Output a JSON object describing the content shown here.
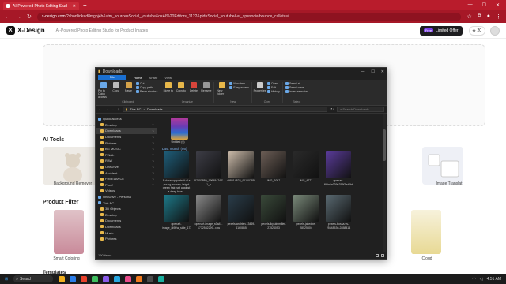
{
  "browser": {
    "tab_title": "AI-Powered Photo Editing Stud",
    "url_domain": "x-design.com",
    "url_rest": "/?shortlink=d8mgpj4h&utm_source=Social_youtube&c=AI%20Editors_1122&pid=Social_youtube&af_sp=socialbounce_callet=ui",
    "window_controls": [
      "—",
      "☐",
      "✕"
    ]
  },
  "site": {
    "logo_letter": "X",
    "logo_text": "X-Design",
    "tagline": "AI-Powered Photo Editing Studio for Product Images",
    "offer_badge": "Free",
    "offer_text": "Limited Offer",
    "credits": "20",
    "sections": {
      "ai_tools": "AI Tools",
      "product_filter": "Product Filter",
      "templates": "Templates"
    },
    "ai_tools": [
      {
        "label": "Background Remover"
      },
      {
        "label": "Image Translat"
      }
    ],
    "filters": [
      {
        "label": "Smart Coloring"
      },
      {
        "label": "Cloud"
      }
    ]
  },
  "explorer": {
    "title": "Downloads",
    "ribbon_tabs": [
      "File",
      "Home",
      "Share",
      "View"
    ],
    "ribbon": {
      "clipboard": {
        "label": "Clipboard",
        "pin": "Pin to Quick access",
        "copy": "Copy",
        "paste": "Paste",
        "cut": "Cut",
        "copy_path": "Copy path",
        "paste_shortcut": "Paste shortcut"
      },
      "organize": {
        "label": "Organize",
        "move_to": "Move to",
        "copy_to": "Copy to",
        "delete": "Delete",
        "rename": "Rename"
      },
      "new": {
        "label": "New",
        "new_folder": "New folder",
        "new_item": "New item",
        "easy_access": "Easy access"
      },
      "open": {
        "label": "Open",
        "properties": "Properties",
        "open": "Open",
        "edit": "Edit",
        "history": "History"
      },
      "select": {
        "label": "Select",
        "select_all": "Select all",
        "select_none": "Select none",
        "invert": "Invert selection"
      }
    },
    "breadcrumb": [
      "This PC",
      "Downloads"
    ],
    "search_placeholder": "Search Downloads",
    "nav": [
      {
        "label": "Quick access",
        "section": true
      },
      {
        "label": "Desktop",
        "pin": true
      },
      {
        "label": "Downloads",
        "pin": true,
        "selected": true
      },
      {
        "label": "Documents",
        "pin": true
      },
      {
        "label": "Pictures",
        "pin": true
      },
      {
        "label": "BG MUSIC",
        "pin": true
      },
      {
        "label": "FINAL",
        "pin": true
      },
      {
        "label": "RAW",
        "pin": true
      },
      {
        "label": "OneDrive",
        "pin": true
      },
      {
        "label": "Accident",
        "pin": true
      },
      {
        "label": "FREELANCE",
        "pin": true
      },
      {
        "label": "Proof",
        "pin": true
      },
      {
        "label": "Videos",
        "pin": false
      },
      {
        "label": "OneDrive - Personal",
        "section": true
      },
      {
        "label": "This PC",
        "section": true
      },
      {
        "label": "3D Objects",
        "pin": false
      },
      {
        "label": "Desktop",
        "pin": false
      },
      {
        "label": "Documents",
        "pin": false
      },
      {
        "label": "Downloads",
        "pin": false
      },
      {
        "label": "Music",
        "pin": false
      },
      {
        "label": "Pictures",
        "pin": false
      }
    ],
    "top_file": {
      "name": "Untitled (6)"
    },
    "group_label": "Last month (86)",
    "files_row1": [
      {
        "name": "A close-up portrait of a young woman, bright green hair, set against a deep blue...",
        "color": "#1e5e7a"
      },
      {
        "name": "87307889_1964847421560505_182140050...73848 1_n",
        "color": "#3d3d46"
      },
      {
        "name": "498514823_911602856875329_677419442...2566356_n",
        "color": "#c9b9a8"
      },
      {
        "name": "IMG_2087",
        "color": "#6b5d55"
      },
      {
        "name": "IMG_4777",
        "color": "#2a2a2a"
      },
      {
        "name": "openart-f99a5a039e259f2ed0bb6d7cc2e8e07_raw",
        "color": "#5a3b9a"
      }
    ],
    "files_row2": [
      {
        "name": "openart-image_8t9Ew_side_1732576...raw",
        "color": "#1d7a8a"
      },
      {
        "name": "openart-image_s0a4... 1732582299...raw",
        "color": "#8a8a8a"
      },
      {
        "name": "pexels-andrien...3469-4160865",
        "color": "#2a3d4a"
      },
      {
        "name": "pexels-lkyluksmiller-27524053",
        "color": "#3a4a3a"
      },
      {
        "name": "pexels-jakedpe-28525304",
        "color": "#7a8a7a"
      },
      {
        "name": "pexels-bossa-vs-25648536-2858414",
        "color": "#5a6a72"
      }
    ],
    "status": "190 items"
  },
  "taskbar": {
    "search": "Search",
    "time": "4:51 AM",
    "apps": [
      "#f2b01e",
      "#2b7de9",
      "#e9412b",
      "#3fbf5f",
      "#8a5be9",
      "#29a8e0",
      "#e94b8a",
      "#f07a1e",
      "#4a4a4a",
      "#1ab0a0"
    ]
  }
}
